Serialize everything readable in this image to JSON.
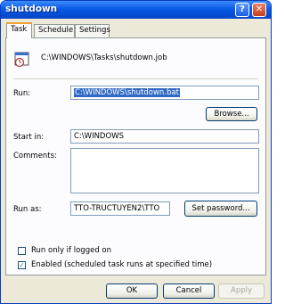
{
  "window": {
    "title": "shutdown",
    "help_glyph": "?",
    "close_glyph": "✕"
  },
  "tabs": [
    "Task",
    "Schedule",
    "Settings"
  ],
  "task": {
    "path": "C:\\WINDOWS\\Tasks\\shutdown.job",
    "run_label": "Run:",
    "run_value": "C:\\WINDOWS\\shutdown.bat",
    "browse_label": "Browse...",
    "start_in_label": "Start in:",
    "start_in_value": "C:\\WINDOWS",
    "comments_label": "Comments:",
    "comments_value": "",
    "run_as_label": "Run as:",
    "run_as_value": "TTO-TRUCTUYEN2\\TTO",
    "set_password_label": "Set password...",
    "run_only_logged_on_label": "Run only if logged on",
    "run_only_logged_on_checked": false,
    "enabled_label": "Enabled (scheduled task runs at specified time)",
    "enabled_checked": true
  },
  "buttons": {
    "ok": "OK",
    "cancel": "Cancel",
    "apply": "Apply"
  }
}
